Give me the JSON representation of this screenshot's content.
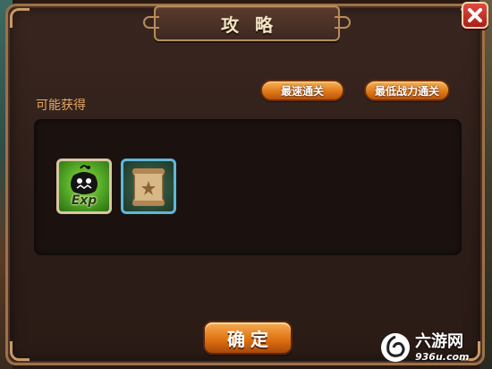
{
  "window": {
    "title": "攻略"
  },
  "buttons": {
    "fastest_clear": "最速通关",
    "lowest_power_clear": "最低战力通关",
    "confirm": "确定",
    "close": "close-icon"
  },
  "rewards": {
    "label": "可能获得",
    "items": [
      {
        "icon": "exp-bag-icon",
        "text": "Exp"
      },
      {
        "icon": "scroll-icon"
      }
    ]
  },
  "watermark": {
    "title": "六游网",
    "url": "936u.com"
  },
  "colors": {
    "panel_border": "#9d7148",
    "button_orange": "#e07a18",
    "label_orange": "#e6a866",
    "close_red": "#c8322a"
  }
}
